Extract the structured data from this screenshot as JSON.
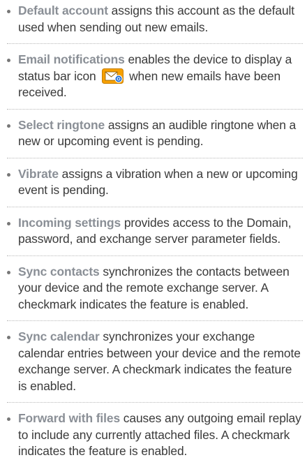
{
  "items": [
    {
      "term": "Default account",
      "desc": " assigns this account as the default used when sending out new emails."
    },
    {
      "term": "Email notifications",
      "desc_before_icon": " enables the device to display a status bar icon",
      "icon": "email-notification-icon",
      "desc_after_icon": " when new emails have been received."
    },
    {
      "term": "Select ringtone",
      "desc": " assigns an audible ringtone when a new or upcoming event is pending."
    },
    {
      "term": "Vibrate",
      "desc": " assigns a vibration when a new or upcoming event is pending."
    },
    {
      "term": "Incoming settings",
      "desc": " provides access to the Domain, password, and exchange server parameter fields."
    },
    {
      "term": "Sync contacts",
      "desc": " synchronizes the contacts between your device and the remote exchange server. A checkmark indicates the feature is enabled."
    },
    {
      "term": "Sync calendar",
      "desc": " synchronizes your exchange calendar entries between your device and the remote exchange server. A checkmark indicates the feature is enabled."
    },
    {
      "term": "Forward with files",
      "desc": " causes any outgoing email replay to include any currently attached files. A checkmark indicates the feature is enabled."
    }
  ],
  "colors": {
    "term": "#8a8f96",
    "body": "#3a3a3a",
    "icon_bg": "#f6a000",
    "icon_badge": "#1e6fd9"
  }
}
